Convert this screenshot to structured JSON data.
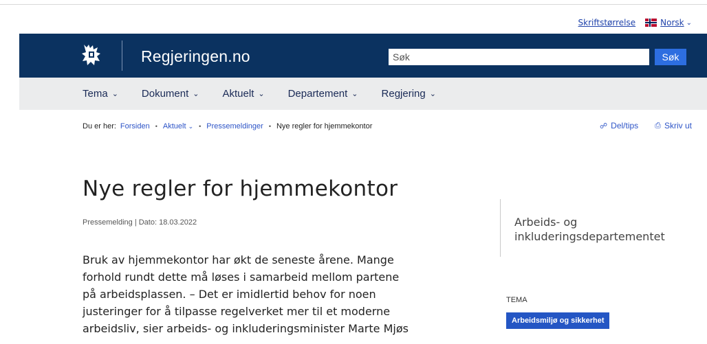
{
  "utility": {
    "font_size_link": "Skriftstørrelse",
    "language_label": "Norsk"
  },
  "header": {
    "site_name": "Regjeringen.no",
    "search_placeholder": "Søk",
    "search_button": "Søk",
    "background_color": "#0b3260",
    "accent_color": "#2d6ee0"
  },
  "nav": {
    "items": [
      {
        "label": "Tema"
      },
      {
        "label": "Dokument"
      },
      {
        "label": "Aktuelt"
      },
      {
        "label": "Departement"
      },
      {
        "label": "Regjering"
      }
    ]
  },
  "breadcrumb": {
    "prefix": "Du er her:",
    "items": [
      {
        "label": "Forsiden"
      },
      {
        "label": "Aktuelt"
      },
      {
        "label": "Pressemeldinger"
      },
      {
        "label": "Nye regler for hjemmekontor"
      }
    ]
  },
  "tools": {
    "share_label": "Del/tips",
    "print_label": "Skriv ut"
  },
  "article": {
    "title": "Nye regler for hjemmekontor",
    "meta": "Pressemelding | Dato: 18.03.2022",
    "lead_lines": [
      "Bruk av hjemmekontor har økt de seneste årene. Mange",
      "forhold rundt dette må løses i samarbeid mellom partene",
      "på arbeidsplassen. – Det er imidlertid behov for noen",
      "justeringer for å tilpasse regelverket mer til et moderne",
      "arbeidsliv, sier arbeids- og inkluderingsminister Marte Mjøs"
    ]
  },
  "aside": {
    "department_lines": [
      "Arbeids- og",
      "inkluderingsdepartementet"
    ],
    "tema_label": "TEMA",
    "tema_tag": "Arbeidsmiljø og sikkerhet",
    "tag_color": "#2456c4"
  }
}
